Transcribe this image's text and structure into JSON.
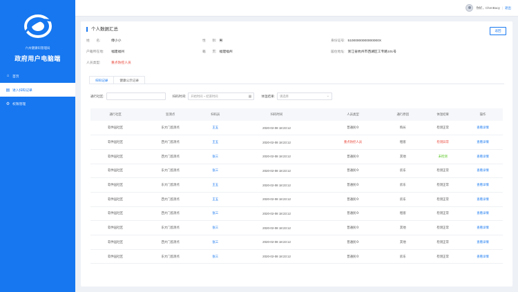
{
  "sidebar": {
    "org_small": "六州健康码管理局",
    "org_big": "政府用户电脑端",
    "items": [
      {
        "label": "首页",
        "icon": "home-icon"
      },
      {
        "label": "进入扫码记录",
        "icon": "record-icon"
      },
      {
        "label": "权限管理",
        "icon": "gear-icon"
      }
    ]
  },
  "topbar": {
    "user": "你好，ChenBaoy",
    "separator": "|",
    "logout": "退出"
  },
  "card": {
    "title": "个人数据汇总",
    "back": "返回"
  },
  "info": {
    "name_label": "姓　　名:",
    "name": "傅小小",
    "gender_label": "性　　别:",
    "gender": "男",
    "id_label": "身份证号:",
    "id": "51000000000000000X",
    "hukou_label": "户籍所在地:",
    "hukou": "福建福州",
    "native_label": "籍　　贯:",
    "native": "福建福州",
    "address_label": "居住地址:",
    "address": "浙江省杭州市西湖区工专路101号",
    "type_label": "人员类型:",
    "type": "重点防控人员"
  },
  "tabs": [
    "扫码记录",
    "健康公示记录"
  ],
  "filters": {
    "community_label": "通行社区:",
    "time_label": "扫码时间:",
    "time_placeholder": "开始时间 ~ 结束时间",
    "result_label": "体温结果:",
    "result_placeholder": "请选择"
  },
  "table": {
    "headers": [
      "通行社区",
      "监测点",
      "扫码员",
      "扫码时间",
      "人员类型",
      "通行原因",
      "体温结果",
      "操作"
    ],
    "rows": [
      {
        "community": "软件园社区",
        "point": "东大门监测点",
        "staff": "王五",
        "time": "2020-02-08 18:23:12",
        "type": "普通民众",
        "reason": "购长",
        "result": "检测正常",
        "action": "查看详情"
      },
      {
        "community": "软件园社区",
        "point": "西大门监测点",
        "staff": "王五",
        "time": "2020-02-08 18:23:12",
        "type": "重点防控人员",
        "reason": "租客",
        "result": "检测异常",
        "action": "查看详情"
      },
      {
        "community": "软件园社区",
        "point": "西大门监测点",
        "staff": "张三",
        "time": "2020-02-08 18:23:12",
        "type": "普通民众",
        "reason": "其他",
        "result": "未检测",
        "action": "查看详情"
      },
      {
        "community": "软件园社区",
        "point": "东大门监测点",
        "staff": "张三",
        "time": "2020-02-08 18:23:12",
        "type": "普通民众",
        "reason": "房东",
        "result": "检测正常",
        "action": "查看详情"
      },
      {
        "community": "软件园社区",
        "point": "东大门监测点",
        "staff": "王五",
        "time": "2020-02-08 18:23:12",
        "type": "普通民众",
        "reason": "房东",
        "result": "检测正常",
        "action": "查看详情"
      },
      {
        "community": "软件园社区",
        "point": "西大门监测点",
        "staff": "王五",
        "time": "2020-02-08 18:23:12",
        "type": "普通民众",
        "reason": "房东",
        "result": "检测正常",
        "action": "查看详情"
      },
      {
        "community": "软件园社区",
        "point": "西大门监测点",
        "staff": "张三",
        "time": "2020-02-08 18:23:12",
        "type": "普通民众",
        "reason": "租客",
        "result": "检测正常",
        "action": "查看详情"
      },
      {
        "community": "软件园社区",
        "point": "东大门监测点",
        "staff": "张三",
        "time": "2020-02-08 18:23:12",
        "type": "普通民众",
        "reason": "其他",
        "result": "检测正常",
        "action": "查看详情"
      },
      {
        "community": "软件园社区",
        "point": "西大门监测点",
        "staff": "张三",
        "time": "2020-02-08 18:23:12",
        "type": "普通民众",
        "reason": "其他",
        "result": "检测正常",
        "action": "查看详情"
      },
      {
        "community": "软件园社区",
        "point": "东大门监测点",
        "staff": "张三",
        "time": "2020-02-08 18:23:12",
        "type": "普通民众",
        "reason": "房东",
        "result": "检测正常",
        "action": "查看详情"
      }
    ]
  },
  "colors": {
    "primary": "#1677f0",
    "danger": "#e9463a",
    "success": "#52c41a"
  }
}
